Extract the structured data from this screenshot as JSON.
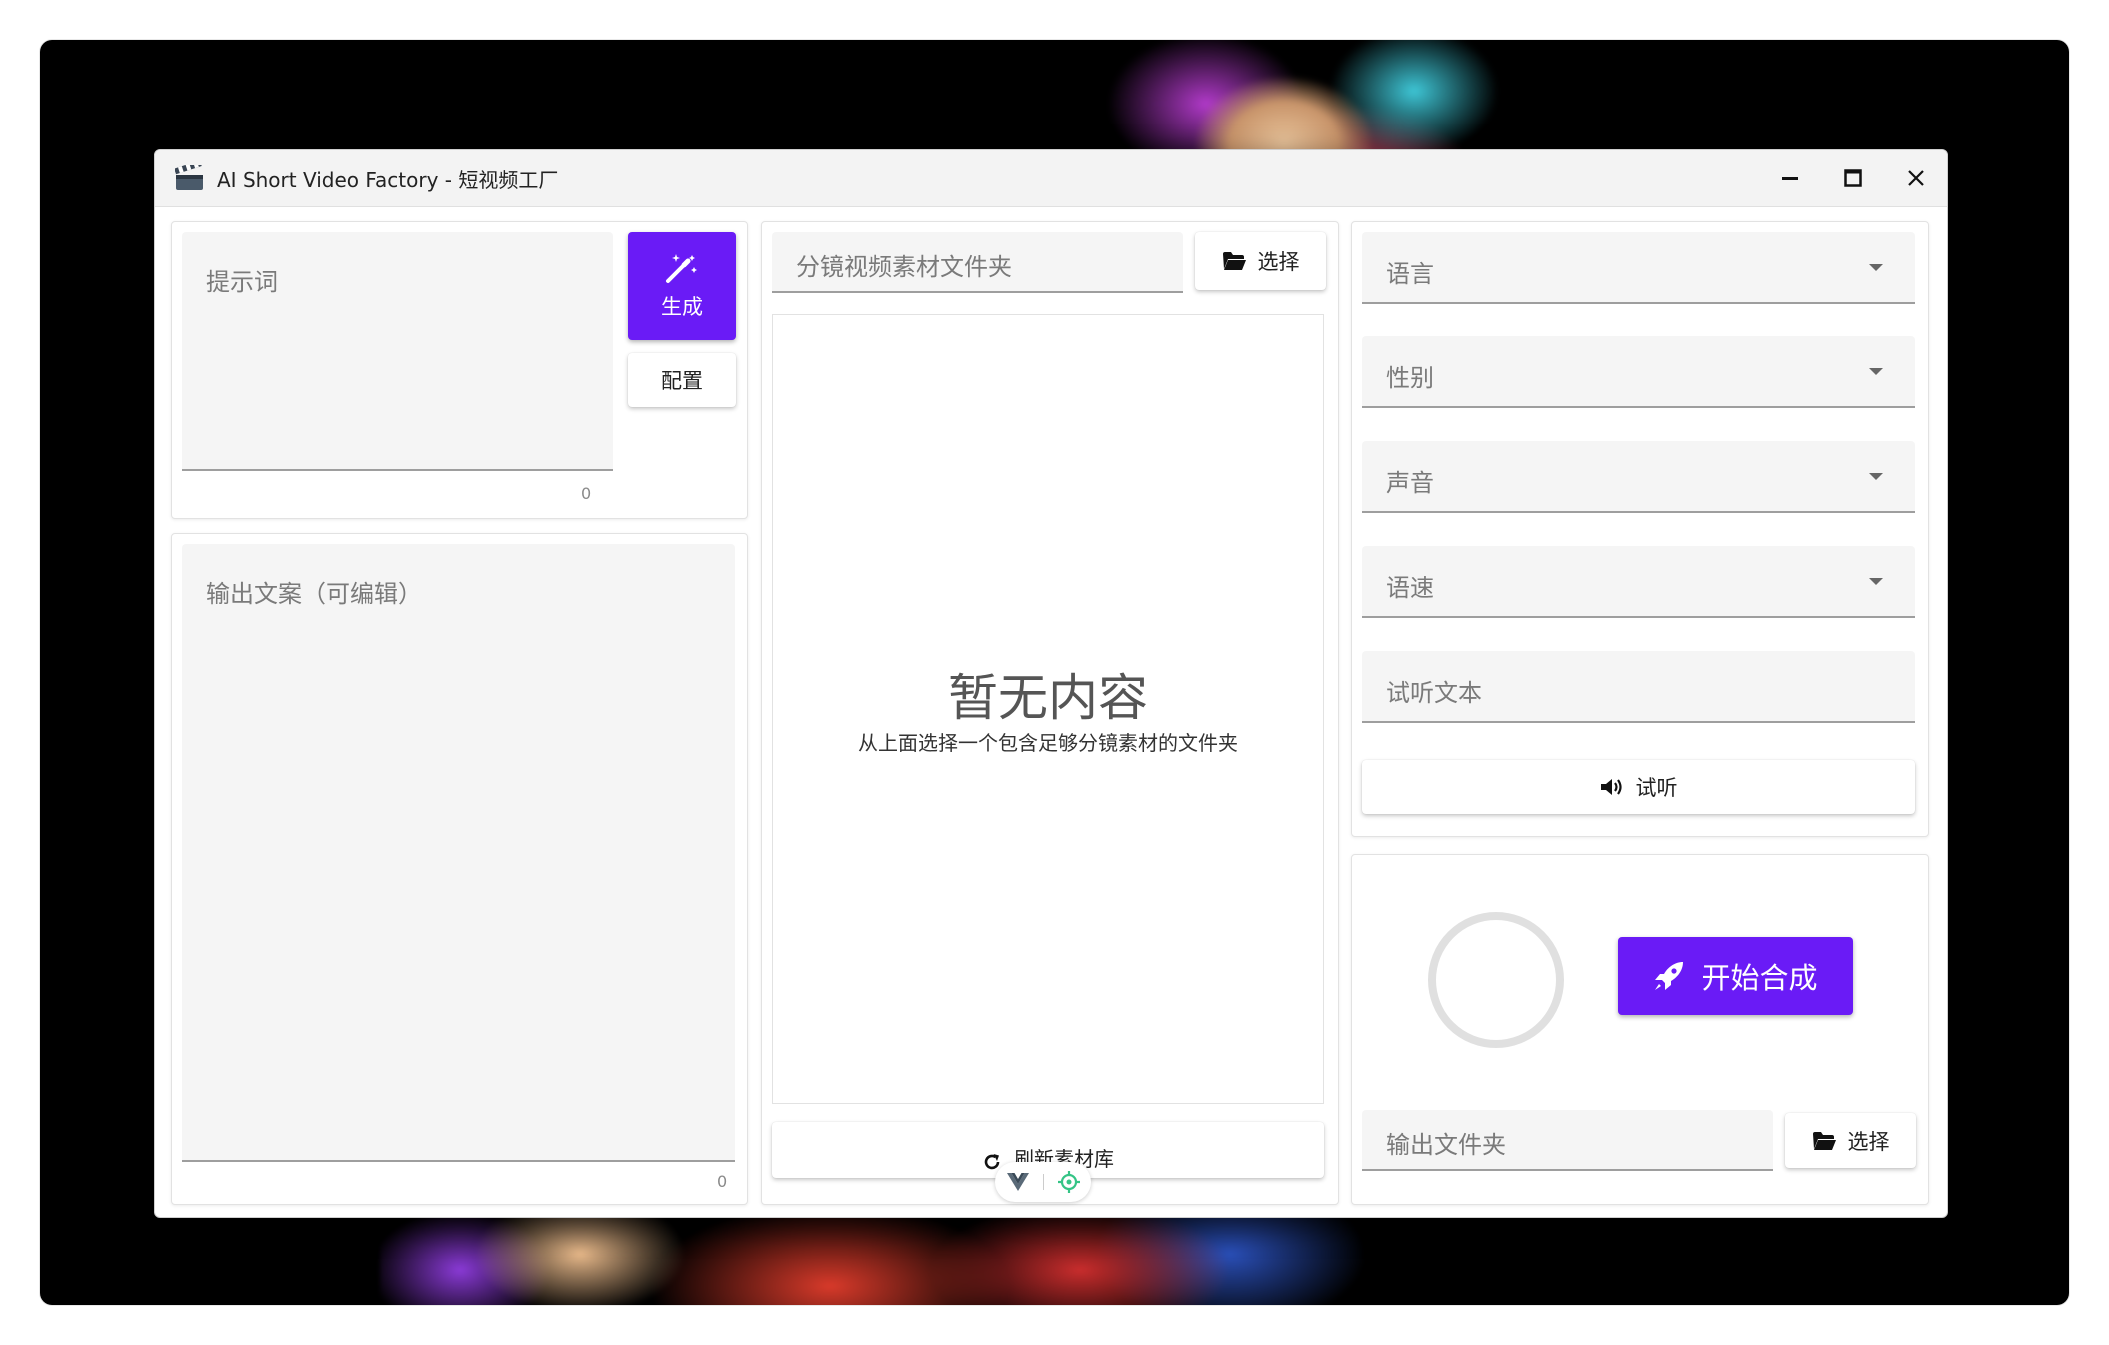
{
  "window": {
    "title": "AI Short Video Factory - 短视频工厂"
  },
  "prompt": {
    "label": "提示词",
    "count": "0",
    "generate_label": "生成",
    "config_label": "配置"
  },
  "output_copy": {
    "label": "输出文案（可编辑）",
    "count": "0"
  },
  "storyboard": {
    "folder_label": "分镜视频素材文件夹",
    "select_label": "选择",
    "empty_title": "暂无内容",
    "empty_hint": "从上面选择一个包含足够分镜素材的文件夹",
    "refresh_label": "刷新素材库"
  },
  "tts": {
    "language_label": "语言",
    "gender_label": "性别",
    "voice_label": "声音",
    "speed_label": "语速",
    "preview_text_label": "试听文本",
    "listen_label": "试听"
  },
  "compose": {
    "start_label": "开始合成",
    "output_folder_label": "输出文件夹",
    "select_label": "选择"
  },
  "colors": {
    "accent": "#6a1bf6",
    "devtools_green": "#35c486"
  }
}
